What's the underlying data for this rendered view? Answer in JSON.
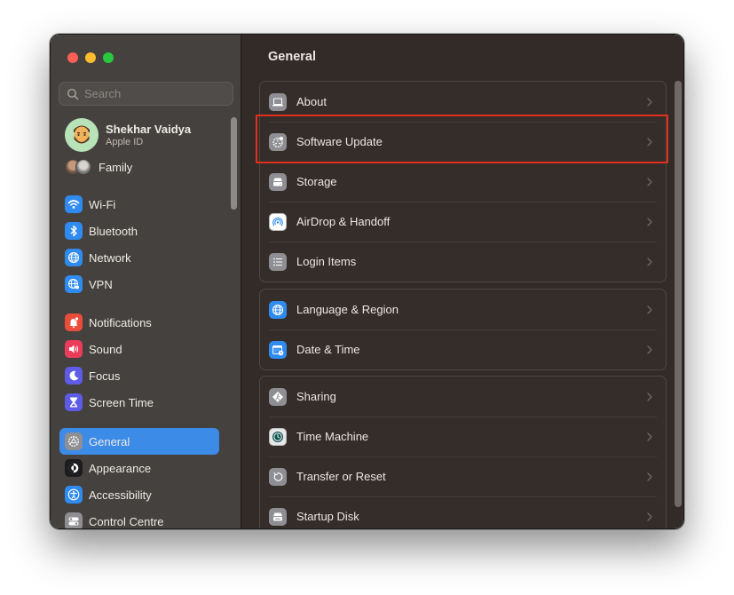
{
  "window": {
    "traffic_lights": [
      "close",
      "minimize",
      "maximize"
    ]
  },
  "sidebar": {
    "search": {
      "placeholder": "Search",
      "value": ""
    },
    "profile": {
      "name": "Shekhar Vaidya",
      "subtitle": "Apple ID"
    },
    "family": {
      "label": "Family"
    },
    "items": [
      {
        "label": "Wi-Fi",
        "icon": "wifi-icon",
        "color": "#2f8bf0"
      },
      {
        "label": "Bluetooth",
        "icon": "bluetooth-icon",
        "color": "#2f8bf0"
      },
      {
        "label": "Network",
        "icon": "globe-icon",
        "color": "#2f8bf0"
      },
      {
        "label": "VPN",
        "icon": "vpn-globe-icon",
        "color": "#2f8bf0"
      },
      {
        "label": "Notifications",
        "icon": "bell-icon",
        "color": "#eb4d3d"
      },
      {
        "label": "Sound",
        "icon": "speaker-icon",
        "color": "#eb3d5a"
      },
      {
        "label": "Focus",
        "icon": "moon-icon",
        "color": "#5e5ce6"
      },
      {
        "label": "Screen Time",
        "icon": "hourglass-icon",
        "color": "#5e5ce6"
      },
      {
        "label": "General",
        "icon": "gear-icon",
        "color": "#8e8e93",
        "active": true
      },
      {
        "label": "Appearance",
        "icon": "appearance-icon",
        "color": "#1c1c1e"
      },
      {
        "label": "Accessibility",
        "icon": "accessibility-icon",
        "color": "#2f8bf0"
      },
      {
        "label": "Control Centre",
        "icon": "control-centre-icon",
        "color": "#8e8e93"
      }
    ]
  },
  "main": {
    "title": "General",
    "groups": [
      {
        "rows": [
          {
            "label": "About",
            "icon": "laptop-icon",
            "color": "#8e8e93"
          },
          {
            "label": "Software Update",
            "icon": "software-update-icon",
            "color": "#8e8e93",
            "highlighted": true
          },
          {
            "label": "Storage",
            "icon": "storage-icon",
            "color": "#8e8e93"
          },
          {
            "label": "AirDrop & Handoff",
            "icon": "airdrop-icon",
            "color": "#ffffff"
          },
          {
            "label": "Login Items",
            "icon": "list-icon",
            "color": "#8e8e93"
          }
        ]
      },
      {
        "rows": [
          {
            "label": "Language & Region",
            "icon": "globe-icon",
            "color": "#2f8bf0"
          },
          {
            "label": "Date & Time",
            "icon": "calendar-clock-icon",
            "color": "#2f8bf0"
          }
        ]
      },
      {
        "rows": [
          {
            "label": "Sharing",
            "icon": "sharing-icon",
            "color": "#8e8e93"
          },
          {
            "label": "Time Machine",
            "icon": "time-machine-icon",
            "color": "#e8e8e8"
          },
          {
            "label": "Transfer or Reset",
            "icon": "reset-icon",
            "color": "#8e8e93"
          },
          {
            "label": "Startup Disk",
            "icon": "disk-icon",
            "color": "#8e8e93"
          }
        ]
      }
    ]
  },
  "colors": {
    "accent": "#3c8be6",
    "highlight_box": "#e0301e"
  }
}
